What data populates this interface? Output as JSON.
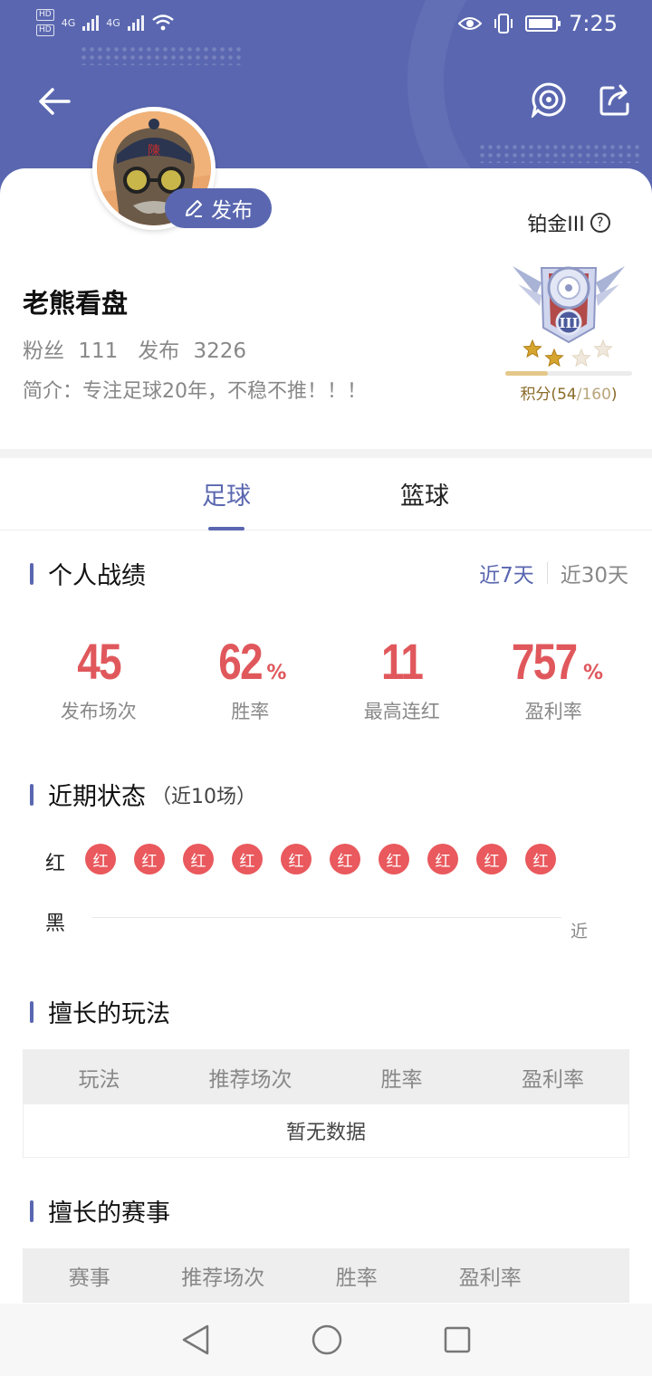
{
  "status_bar": {
    "sim1": "HD",
    "sim2": "HD",
    "net1": "4G",
    "net2": "4G",
    "time": "7:25"
  },
  "header": {
    "back_icon": "arrow-left-icon",
    "actions": [
      "target-chat-icon",
      "share-icon"
    ]
  },
  "profile": {
    "publish_label": "发布",
    "name": "老熊看盘",
    "fans_label": "粉丝",
    "fans_count": "111",
    "posts_label": "发布",
    "posts_count": "3226",
    "intro_label": "简介：",
    "intro_text": "专注足球20年，不稳不推！！！"
  },
  "rank": {
    "title": "铂金III",
    "help_icon": "question-circle-icon",
    "score_prefix": "积分(",
    "score_current": "54",
    "score_sep": "/",
    "score_total": "160",
    "score_suffix": ")",
    "progress": 0.3375,
    "stars_filled": 2,
    "stars_total": 3
  },
  "tabs": [
    "足球",
    "篮球"
  ],
  "performance": {
    "title": "个人战绩",
    "periods": [
      "近7天",
      "近30天"
    ],
    "stats": [
      {
        "value": "45",
        "unit": "",
        "label": "发布场次"
      },
      {
        "value": "62",
        "unit": "%",
        "label": "胜率"
      },
      {
        "value": "11",
        "unit": "",
        "label": "最高连红"
      },
      {
        "value": "757",
        "unit": "%",
        "label": "盈利率"
      }
    ]
  },
  "recent": {
    "title": "近期状态",
    "subtitle": "（近10场）",
    "red_label": "红",
    "black_label": "黑",
    "dot_text": "红",
    "results": [
      "红",
      "红",
      "红",
      "红",
      "红",
      "红",
      "红",
      "红",
      "红",
      "红"
    ],
    "axis_label": "近"
  },
  "good_plays": {
    "title": "擅长的玩法",
    "columns": [
      "玩法",
      "推荐场次",
      "胜率",
      "盈利率"
    ],
    "empty": "暂无数据"
  },
  "good_leagues": {
    "title": "擅长的赛事",
    "columns": [
      "赛事",
      "推荐场次",
      "胜率",
      "盈利率"
    ]
  },
  "colors": {
    "brand": "#5a67b0",
    "red": "#e9595d"
  }
}
